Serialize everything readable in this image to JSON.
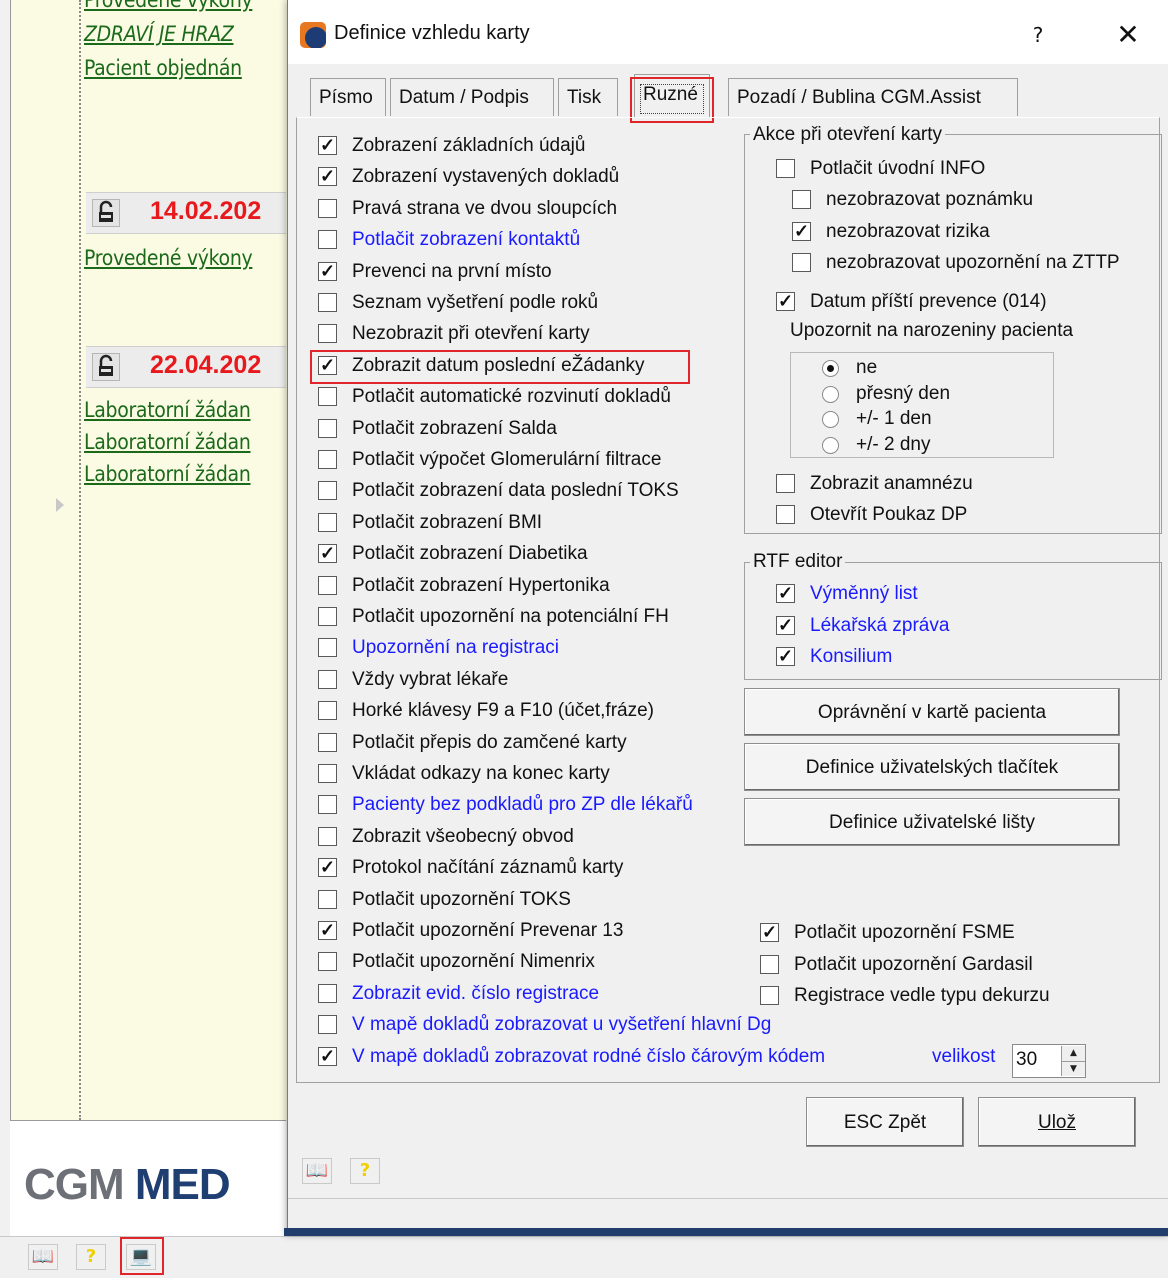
{
  "background": {
    "links_top": [
      "Provedené výkony",
      "ZDRAVÍ JE HRAZ",
      "Pacient objednán"
    ],
    "date1": "14.02.202",
    "link_mid": "Provedené výkony",
    "date2": "22.04.202",
    "lab_links": [
      "Laboratorní žádan",
      "Laboratorní žádan",
      "Laboratorní žádan"
    ],
    "logo_gray": "CGM ",
    "logo_blue": "MED"
  },
  "dialog": {
    "title": "Definice vzhledu karty",
    "help": "?",
    "close": "✕",
    "tabs": [
      "Písmo",
      "Datum / Podpis",
      "Tisk",
      "Ruzné",
      "Pozadí / Bublina CGM.Assist"
    ],
    "left_options": [
      {
        "label": "Zobrazení základních údajů",
        "checked": true
      },
      {
        "label": "Zobrazení vystavených dokladů",
        "checked": true
      },
      {
        "label": "Pravá strana ve dvou sloupcích",
        "checked": false
      },
      {
        "label": "Potlačit zobrazení kontaktů",
        "checked": false,
        "blue": true
      },
      {
        "label": "Prevenci na první místo",
        "checked": true
      },
      {
        "label": "Seznam vyšetření podle roků",
        "checked": false
      },
      {
        "label": "Nezobrazit při otevření karty",
        "checked": false
      },
      {
        "label": "Zobrazit datum poslední eŽádanky",
        "checked": true
      },
      {
        "label": "Potlačit automatické rozvinutí dokladů",
        "checked": false
      },
      {
        "label": "Potlačit zobrazení Salda",
        "checked": false
      },
      {
        "label": "Potlačit výpočet Glomerulární filtrace",
        "checked": false
      },
      {
        "label": "Potlačit zobrazení data poslední TOKS",
        "checked": false
      },
      {
        "label": "Potlačit zobrazení BMI",
        "checked": false
      },
      {
        "label": "Potlačit zobrazení Diabetika",
        "checked": true
      },
      {
        "label": "Potlačit zobrazení Hypertonika",
        "checked": false
      },
      {
        "label": "Potlačit upozornění na potenciální FH",
        "checked": false
      },
      {
        "label": "Upozornění na registraci",
        "checked": false,
        "blue": true
      },
      {
        "label": "Vždy vybrat lékaře",
        "checked": false
      },
      {
        "label": "Horké klávesy F9 a F10 (účet,fráze)",
        "checked": false
      },
      {
        "label": "Potlačit přepis do zamčené karty",
        "checked": false
      },
      {
        "label": "Vkládat odkazy na konec karty",
        "checked": false
      },
      {
        "label": "Pacienty bez podkladů pro ZP dle lékařů",
        "checked": false,
        "blue": true
      },
      {
        "label": "Zobrazit všeobecný obvod",
        "checked": false
      },
      {
        "label": "Protokol načítání záznamů karty",
        "checked": true
      },
      {
        "label": "Potlačit upozornění TOKS",
        "checked": false
      },
      {
        "label": "Potlačit upozornění Prevenar 13",
        "checked": true
      },
      {
        "label": "Potlačit upozornění Nimenrix",
        "checked": false
      },
      {
        "label": "Zobrazit evid. číslo registrace",
        "checked": false,
        "blue": true
      },
      {
        "label": "V mapě dokladů zobrazovat u vyšetření hlavní Dg",
        "checked": false,
        "blue": true
      },
      {
        "label": "V mapě dokladů zobrazovat rodné číslo čárovým kódem",
        "checked": true,
        "blue": true
      }
    ],
    "akce": {
      "title": "Akce při otevření karty",
      "potlacit_info": {
        "label": "Potlačit úvodní INFO",
        "checked": false
      },
      "sub": [
        {
          "label": "nezobrazovat poznámku",
          "checked": false
        },
        {
          "label": "nezobrazovat rizika",
          "checked": true
        },
        {
          "label": "nezobrazovat upozornění na ZTTP",
          "checked": false
        }
      ],
      "datum_prevence": {
        "label": "Datum příští prevence (014)",
        "checked": true
      },
      "narozeniny_label": "Upozornit na narozeniny pacienta",
      "radios": [
        {
          "label": "ne",
          "selected": true
        },
        {
          "label": "přesný den",
          "selected": false
        },
        {
          "label": "+/-  1 den",
          "selected": false
        },
        {
          "label": "+/-  2 dny",
          "selected": false
        }
      ],
      "anamneza": {
        "label": "Zobrazit anamnézu",
        "checked": false
      },
      "poukaz": {
        "label": "Otevřít Poukaz DP",
        "checked": false
      }
    },
    "rtf": {
      "title": "RTF editor",
      "items": [
        {
          "label": "Výměnný list",
          "checked": true
        },
        {
          "label": "Lékařská zpráva",
          "checked": true
        },
        {
          "label": "Konsilium",
          "checked": true
        }
      ]
    },
    "buttons": {
      "opravneni": "Oprávnění v kartě pacienta",
      "tlacitka": "Definice uživatelských tlačítek",
      "lista": "Definice uživatelské lišty",
      "esc": "ESC Zpět",
      "uloz": "Ulož"
    },
    "right_options": [
      {
        "label": "Potlačit upozornění FSME",
        "checked": true
      },
      {
        "label": "Potlačit upozornění Gardasil",
        "checked": false
      },
      {
        "label": "Registrace vedle typu dekurzu",
        "checked": false
      }
    ],
    "velikost": {
      "label": "velikost",
      "value": "30"
    }
  }
}
